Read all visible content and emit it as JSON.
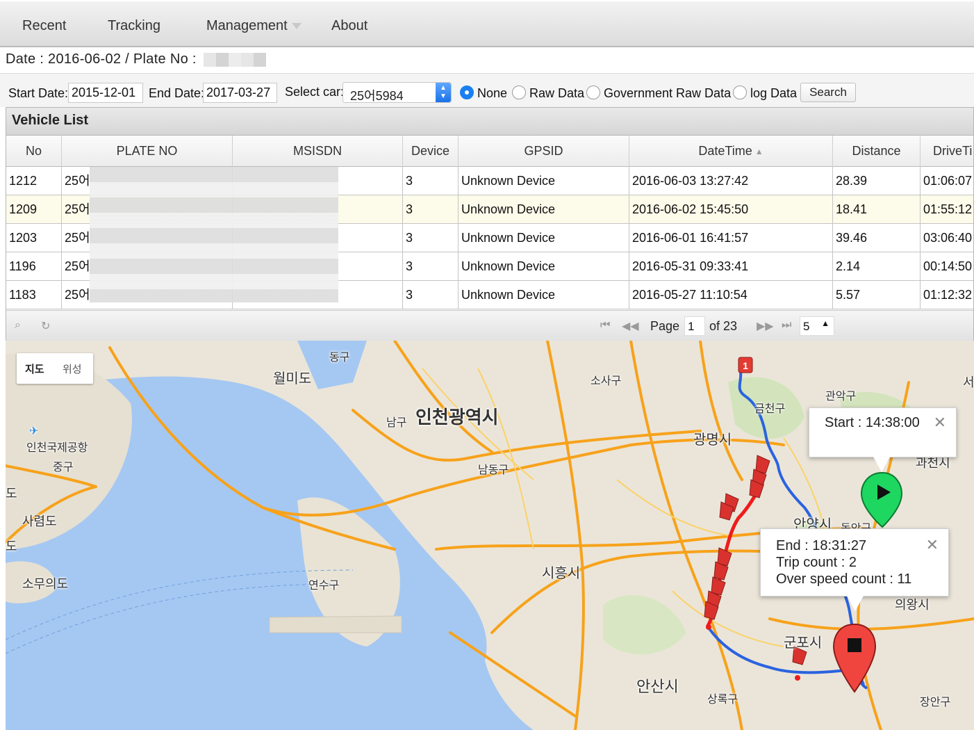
{
  "menu": {
    "items": [
      "Recent",
      "Tracking",
      "Management",
      "About"
    ]
  },
  "info": {
    "date_line": "Date : 2016-06-02 / Plate No :"
  },
  "filter": {
    "start_label": "Start Date:",
    "start_value": "2015-12-01",
    "end_label": "End Date:",
    "end_value": "2017-03-27",
    "car_label": "Select car:",
    "car_value": "25어5984",
    "radios": [
      {
        "label": "None",
        "checked": true
      },
      {
        "label": "Raw Data",
        "checked": false
      },
      {
        "label": "Government Raw Data",
        "checked": false
      },
      {
        "label": "log Data",
        "checked": false
      }
    ],
    "search_label": "Search"
  },
  "grid": {
    "caption": "Vehicle List",
    "columns": [
      "No",
      "PLATE NO",
      "MSISDN",
      "Device",
      "GPSID",
      "DateTime",
      "Distance",
      "DriveTi"
    ],
    "rows": [
      {
        "no": "1212",
        "plate": "25어",
        "msisdn": "",
        "device": "3",
        "gpsid": "Unknown Device",
        "datetime": "2016-06-03 13:27:42",
        "distance": "28.39",
        "drive": "01:06:07"
      },
      {
        "no": "1209",
        "plate": "25어",
        "msisdn": "",
        "device": "3",
        "gpsid": "Unknown Device",
        "datetime": "2016-06-02 15:45:50",
        "distance": "18.41",
        "drive": "01:55:12"
      },
      {
        "no": "1203",
        "plate": "25어",
        "msisdn": "",
        "device": "3",
        "gpsid": "Unknown Device",
        "datetime": "2016-06-01 16:41:57",
        "distance": "39.46",
        "drive": "03:06:40"
      },
      {
        "no": "1196",
        "plate": "25어",
        "msisdn": "",
        "device": "3",
        "gpsid": "Unknown Device",
        "datetime": "2016-05-31 09:33:41",
        "distance": "2.14",
        "drive": "00:14:50"
      },
      {
        "no": "1183",
        "plate": "25어",
        "msisdn": "",
        "device": "3",
        "gpsid": "Unknown Device",
        "datetime": "2016-05-27 11:10:54",
        "distance": "5.57",
        "drive": "01:12:32"
      }
    ],
    "pager": {
      "page_label": "Page",
      "page_value": "1",
      "of_label": "of 23",
      "rows_per_page": "5"
    }
  },
  "map": {
    "tabs": [
      "지도",
      "위성"
    ],
    "labels": [
      "월미도",
      "동구",
      "인천광역시",
      "남구",
      "소사구",
      "금천구",
      "광명시",
      "관악구",
      "과천시",
      "서",
      "인천국제공항",
      "중구",
      "남동구",
      "도",
      "사렴도",
      "도",
      "소무의도",
      "연수구",
      "시흥시",
      "안양시",
      "동안구",
      "의왕시",
      "군포시",
      "안산시",
      "상록구",
      "장안구"
    ],
    "cluster_badge": "1",
    "start_window": {
      "text": "Start : 14:38:00"
    },
    "end_window": {
      "line1": "End : 18:31:27",
      "line2": "Trip count : 2",
      "line3": "Over speed count : 11"
    },
    "colors": {
      "water": "#a5c8f2",
      "land": "#ebe5d9",
      "highway": "#f7a21b",
      "route_blue": "#2a63e0",
      "route_red": "#ee1c1c",
      "start_marker": "#1ed760",
      "end_marker": "#f0453f"
    }
  }
}
